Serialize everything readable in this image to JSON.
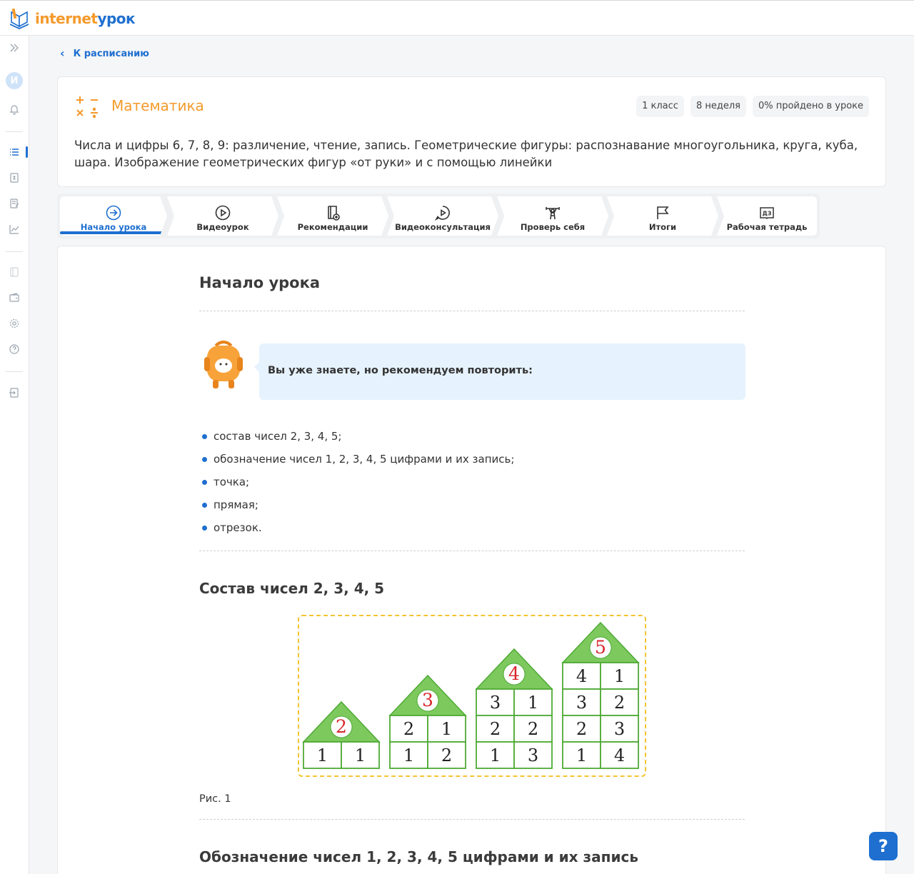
{
  "brand": {
    "part1": "internet",
    "part2": "урок"
  },
  "sidebar": {
    "avatar_letter": "И"
  },
  "back_link": "К расписанию",
  "subject": {
    "name": "Математика",
    "chips": [
      "1 класс",
      "8 неделя",
      "0% пройдено в уроке"
    ],
    "description": "Числа и цифры 6, 7, 8, 9: различение, чтение, запись. Геометрические фигуры: распознавание многоугольника, круга, куба, шара. Изображение геометрических фигур «от руки» и с помощью линейки"
  },
  "tabs": [
    {
      "label": "Начало урока",
      "icon": "arrow-circle-icon",
      "active": true
    },
    {
      "label": "Видеоурок",
      "icon": "play-circle-icon"
    },
    {
      "label": "Рекомендации",
      "icon": "book-plus-icon"
    },
    {
      "label": "Видеоконсультация",
      "icon": "chat-play-icon"
    },
    {
      "label": "Проверь себя",
      "icon": "weightlifter-icon"
    },
    {
      "label": "Итоги",
      "icon": "flag-icon"
    },
    {
      "label": "Рабочая тетрадь",
      "icon": "dz-book-icon"
    }
  ],
  "content": {
    "title": "Начало урока",
    "bubble": "Вы уже знаете, но рекомендуем повторить:",
    "review_items": [
      "состав чисел 2, 3, 4, 5;",
      "обозначение чисел 1, 2, 3, 4, 5 цифрами и их запись;",
      "точка;",
      "прямая;",
      "отрезок."
    ],
    "section1_title": "Состав чисел 2, 3, 4, 5",
    "figure": {
      "houses": [
        {
          "roof": "2",
          "rows": [
            [
              "1",
              "1"
            ]
          ]
        },
        {
          "roof": "3",
          "rows": [
            [
              "2",
              "1"
            ],
            [
              "1",
              "2"
            ]
          ]
        },
        {
          "roof": "4",
          "rows": [
            [
              "3",
              "1"
            ],
            [
              "2",
              "2"
            ],
            [
              "1",
              "3"
            ]
          ]
        },
        {
          "roof": "5",
          "rows": [
            [
              "4",
              "1"
            ],
            [
              "3",
              "2"
            ],
            [
              "2",
              "3"
            ],
            [
              "1",
              "4"
            ]
          ]
        }
      ]
    },
    "caption": "Рис. 1",
    "section2_title": "Обозначение чисел 1, 2, 3, 4, 5 цифрами и их запись"
  },
  "help_label": "?",
  "colors": {
    "accent": "#1e6fd0",
    "brand_orange": "#f49a2b",
    "house_green": "#7dc95e",
    "digit_red": "#d7262b"
  }
}
